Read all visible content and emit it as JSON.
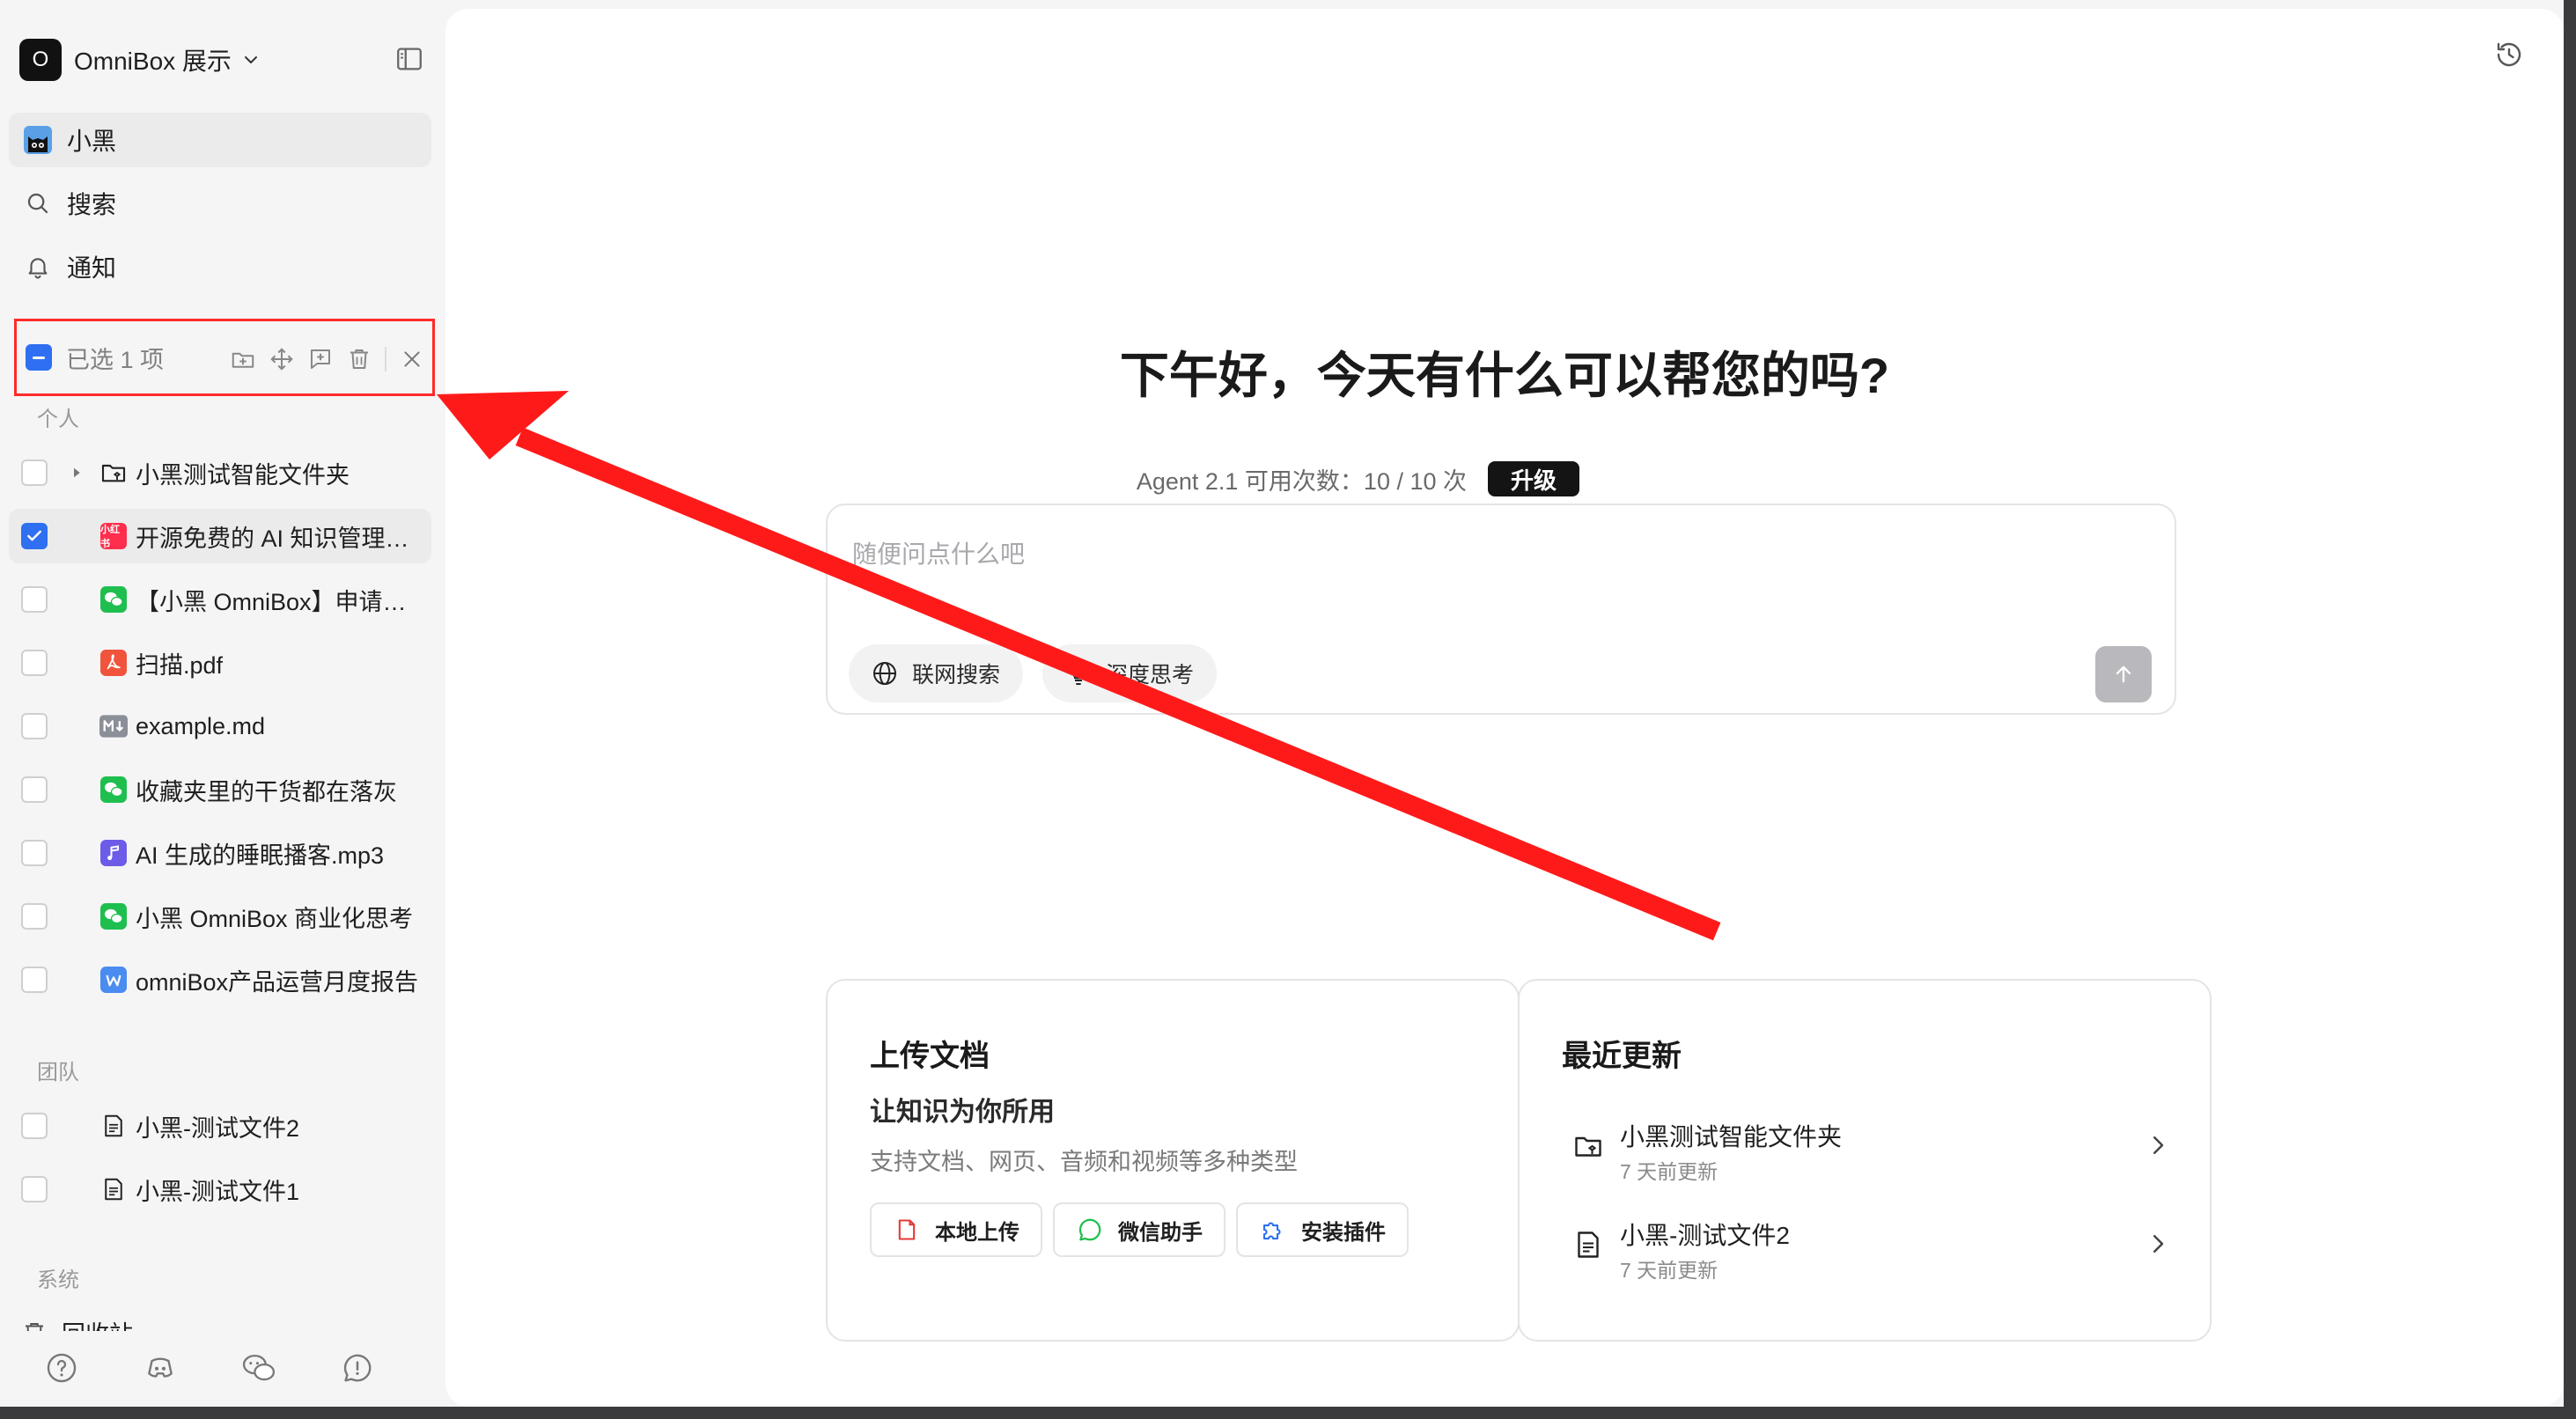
{
  "colors": {
    "accent": "#2f6ff1",
    "annotation": "#ff1a1a",
    "upgrade_bg": "#141414"
  },
  "workspace": {
    "logo_letter": "O",
    "name": "OmniBox 展示"
  },
  "nav": [
    {
      "label": "小黑",
      "icon": "cat-avatar-icon"
    },
    {
      "label": "搜索",
      "icon": "search-icon"
    },
    {
      "label": "通知",
      "icon": "bell-icon"
    }
  ],
  "selection": {
    "text": "已选 1 项"
  },
  "sections": {
    "personal": "个人",
    "team": "团队",
    "system": "系统"
  },
  "personal_items": [
    {
      "name": "小黑测试智能文件夹",
      "type": "smart-folder",
      "checked": false
    },
    {
      "name": "开源免费的 AI 知识管理工具",
      "type": "xiaohongshu",
      "checked": true
    },
    {
      "name": "【小黑 OmniBox】申请内测",
      "type": "wechat",
      "checked": false
    },
    {
      "name": "扫描.pdf",
      "type": "pdf",
      "checked": false
    },
    {
      "name": "example.md",
      "type": "markdown",
      "checked": false
    },
    {
      "name": "收藏夹里的干货都在落灰",
      "type": "wechat",
      "checked": false
    },
    {
      "name": "AI 生成的睡眠播客.mp3",
      "type": "audio",
      "checked": false
    },
    {
      "name": "小黑 OmniBox 商业化思考",
      "type": "wechat",
      "checked": false
    },
    {
      "name": "omniBox产品运营月度报告",
      "type": "word",
      "checked": false
    }
  ],
  "team_items": [
    {
      "name": "小黑-测试文件2",
      "type": "doc",
      "checked": false
    },
    {
      "name": "小黑-测试文件1",
      "type": "doc",
      "checked": false
    }
  ],
  "system_items": [
    {
      "name": "回收站",
      "type": "trash"
    }
  ],
  "main": {
    "greeting": "下午好，今天有什么可以帮您的吗?",
    "quota_text": "Agent 2.1 可用次数：10 / 10 次",
    "upgrade_label": "升级",
    "composer": {
      "placeholder": "随便问点什么吧",
      "web_search": "联网搜索",
      "deep_think": "深度思考"
    },
    "upload_card": {
      "title": "上传文档",
      "subtitle": "让知识为你所用",
      "desc": "支持文档、网页、音频和视频等多种类型",
      "buttons": [
        "本地上传",
        "微信助手",
        "安装插件"
      ]
    },
    "recent_card": {
      "title": "最近更新",
      "items": [
        {
          "name": "小黑测试智能文件夹",
          "time": "7 天前更新"
        },
        {
          "name": "小黑-测试文件2",
          "time": "7 天前更新"
        }
      ]
    }
  }
}
